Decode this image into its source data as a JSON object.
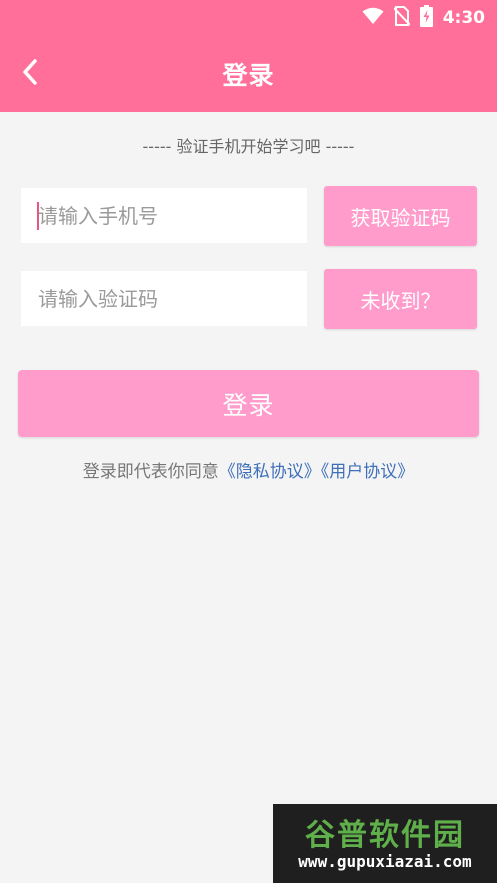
{
  "status_bar": {
    "time": "4:30"
  },
  "header": {
    "title": "登录"
  },
  "subtitle": "----- 验证手机开始学习吧 -----",
  "phone_input": {
    "placeholder": "请输入手机号",
    "value": ""
  },
  "get_code_button": "获取验证码",
  "code_input": {
    "placeholder": "请输入验证码",
    "value": ""
  },
  "not_received_button": "未收到？",
  "login_button": "登录",
  "agreement": {
    "prefix": "登录即代表你同意",
    "privacy_link": "《隐私协议》",
    "user_link": "《用户协议》"
  },
  "watermark": {
    "title": "谷普软件园",
    "url": "www.gupuxiazai.com"
  },
  "colors": {
    "header": "#ff6f9a",
    "button": "#ff9ccb",
    "link": "#3f6fb8",
    "background": "#f4f4f4"
  },
  "icons": [
    "wifi-icon",
    "no-sim-icon",
    "battery-charging-icon",
    "back-arrow-icon"
  ]
}
